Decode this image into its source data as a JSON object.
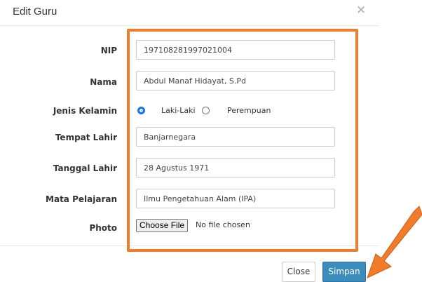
{
  "modal": {
    "title": "Edit Guru",
    "close_symbol": "×"
  },
  "form": {
    "nip": {
      "label": "NIP",
      "value": "197108281997021004"
    },
    "nama": {
      "label": "Nama",
      "value": "Abdul Manaf Hidayat, S.Pd"
    },
    "jenis_kelamin": {
      "label": "Jenis Kelamin",
      "options": [
        "Laki-Laki",
        "Perempuan"
      ],
      "selected": "Laki-Laki"
    },
    "tempat_lahir": {
      "label": "Tempat Lahir",
      "value": "Banjarnegara"
    },
    "tanggal_lahir": {
      "label": "Tanggal Lahir",
      "value": "28 Agustus 1971"
    },
    "mata_pelajaran": {
      "label": "Mata Pelajaran",
      "value": "Ilmu Pengetahuan Alam (IPA)"
    },
    "photo": {
      "label": "Photo",
      "button_label": "Choose File",
      "status": "No file chosen"
    }
  },
  "footer": {
    "close_label": "Close",
    "save_label": "Simpan"
  },
  "colors": {
    "highlight": "#f07b2a",
    "primary_button": "#3c8dbc",
    "radio_checked": "#1a73e8",
    "arrow": "#f07b2a"
  },
  "icons": {
    "close": "close-icon",
    "arrow": "pointer-arrow-icon"
  }
}
